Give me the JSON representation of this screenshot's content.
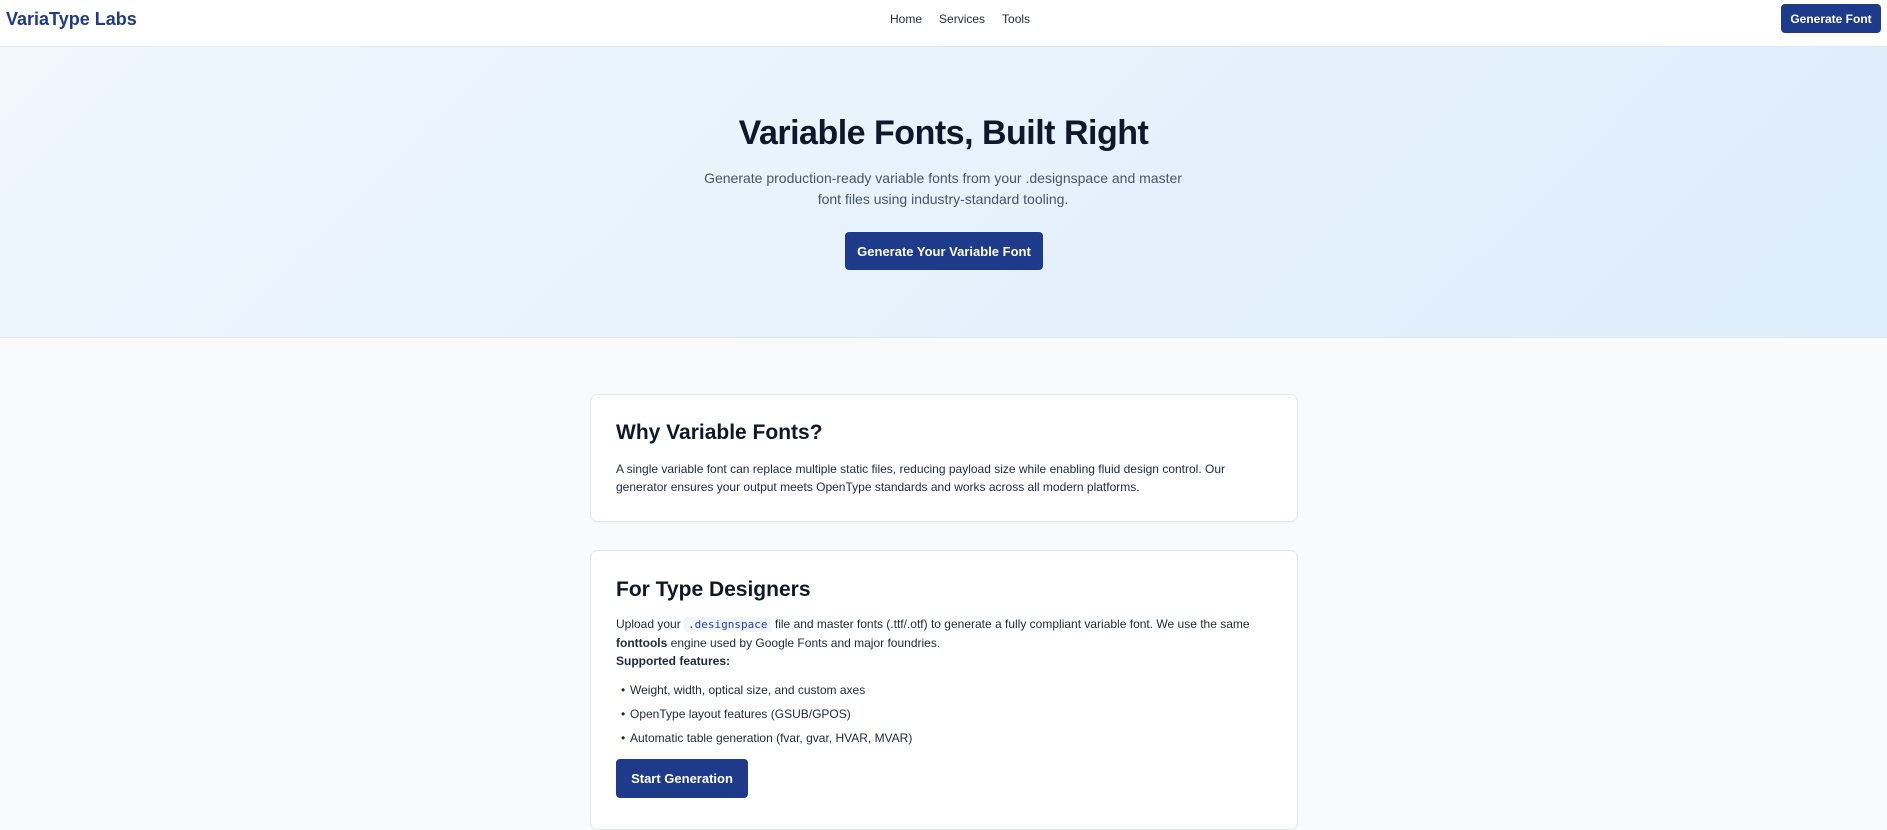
{
  "nav": {
    "brand": "VariaType Labs",
    "links": [
      "Home",
      "Services",
      "Tools"
    ],
    "cta_label": "Generate Font"
  },
  "hero": {
    "title": "Variable Fonts, Built Right",
    "subtitle": "Generate production-ready variable fonts from your .designspace and master font files using industry-standard tooling.",
    "cta_label": "Generate Your Variable Font"
  },
  "why_card": {
    "title": "Why Variable Fonts?",
    "body": "A single variable font can replace multiple static files, reducing payload size while enabling fluid design control. Our generator ensures your output meets OpenType standards and works across all modern platforms."
  },
  "designers_card": {
    "title": "For Type Designers",
    "intro_prefix": "Upload your",
    "intro_code": ".designspace",
    "intro_suffix": "file and master fonts (.ttf/.otf) to generate a fully compliant variable font. We use the same",
    "intro_strong": "fonttools",
    "intro_end": "engine used by Google Fonts and major foundries.",
    "features_label": "Supported features:",
    "bullet_glyph": "•",
    "features": [
      "Weight, width, optical size, and custom axes",
      "OpenType layout features (GSUB/GPOS)",
      "Automatic table generation (fvar, gvar, HVAR, MVAR)"
    ],
    "cta_label": "Start Generation"
  },
  "colors": {
    "primary": "#1e3a8a",
    "hero_bg": "#e4f1fc",
    "page_bg": "#f8fafc"
  }
}
